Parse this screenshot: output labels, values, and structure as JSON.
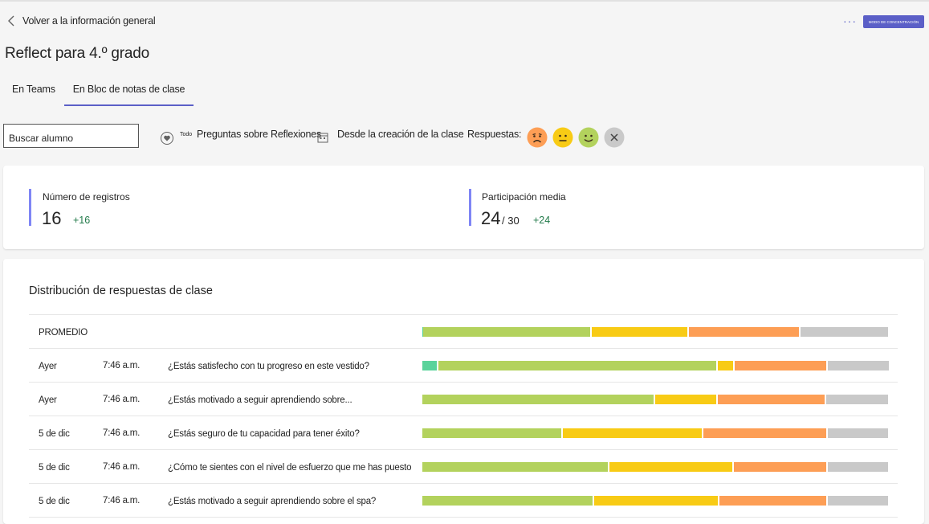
{
  "nav": {
    "back_label": "Volver a la información general",
    "more_label": "···",
    "focus_mode_label": "MODO DE CONCENTRACIÓN"
  },
  "page_title": "Reflect para 4.º grado",
  "tabs": [
    {
      "label": "En Teams",
      "active": false
    },
    {
      "label": "En Bloc de notas de clase",
      "active": true
    }
  ],
  "filters": {
    "search_placeholder": "Buscar alumno",
    "all_label": "Todo",
    "questions_label": "Preguntas sobre Reflexiones",
    "date_range_label": "Desde la creación de la clase",
    "responses_label": "Respuestas:"
  },
  "stats": {
    "records": {
      "label": "Número de registros",
      "value": "16",
      "delta": "+16"
    },
    "participation": {
      "label": "Participación media",
      "value": "24",
      "total": "/ 30",
      "delta": "+24"
    }
  },
  "distribution": {
    "title": "Distribución de respuestas de clase",
    "colors": {
      "teal": "#5ad39b",
      "green": "#b3d25d",
      "yellow": "#f8cb15",
      "orange": "#fd9e55",
      "gray": "#c9c9c9"
    },
    "average": {
      "label": "PROMEDIO",
      "segments": [
        0.2,
        36,
        20.8,
        24,
        19
      ]
    },
    "rows": [
      {
        "day": "Ayer",
        "time": "7:46 a.m.",
        "question": "¿Estás satisfecho con tu progreso en este vestido?",
        "segments": [
          3.5,
          59.8,
          3.6,
          19.9,
          13.4
        ]
      },
      {
        "day": "Ayer",
        "time": "7:46 a.m.",
        "question": "¿Estás motivado a seguir aprendiendo sobre...",
        "segments": [
          0,
          49.8,
          13.4,
          23.3,
          13.5
        ]
      },
      {
        "day": "5 de dic",
        "time": "7:46 a.m.",
        "question": "¿Estás seguro de tu capacidad para tener éxito?",
        "segments": [
          0,
          30,
          30.1,
          26.6,
          13.3
        ]
      },
      {
        "day": "5 de dic",
        "time": "7:46 a.m.",
        "question": "¿Cómo te sientes con el nivel de esfuerzo que me has puesto",
        "segments": [
          0,
          40,
          26.6,
          20.1,
          13.3
        ]
      },
      {
        "day": "5 de dic",
        "time": "7:46 a.m.",
        "question": "¿Estás motivado a seguir aprendiendo sobre el spa?",
        "segments": [
          0,
          36.7,
          26.8,
          23.2,
          13.3
        ]
      }
    ]
  }
}
